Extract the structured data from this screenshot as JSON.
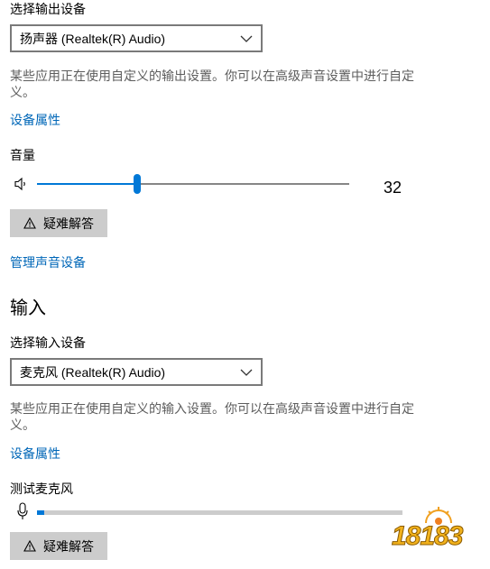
{
  "output": {
    "select_label": "选择输出设备",
    "device": "扬声器 (Realtek(R) Audio)",
    "note": "某些应用正在使用自定义的输出设置。你可以在高级声音设置中进行自定义。",
    "properties_link": "设备属性",
    "volume_label": "音量",
    "volume_value": "32",
    "volume_level_fraction": 0.32,
    "troubleshoot_label": "疑难解答",
    "manage_link": "管理声音设备"
  },
  "input": {
    "heading": "输入",
    "select_label": "选择输入设备",
    "device": "麦克风 (Realtek(R) Audio)",
    "note": "某些应用正在使用自定义的输入设置。你可以在高级声音设置中进行自定义。",
    "properties_link": "设备属性",
    "test_mic_label": "测试麦克风",
    "mic_level_fraction": 0.02,
    "troubleshoot_label": "疑难解答"
  },
  "watermark": {
    "text": "18183"
  },
  "colors": {
    "accent": "#0078d7",
    "link": "#0067b8",
    "button": "#cccccc"
  }
}
